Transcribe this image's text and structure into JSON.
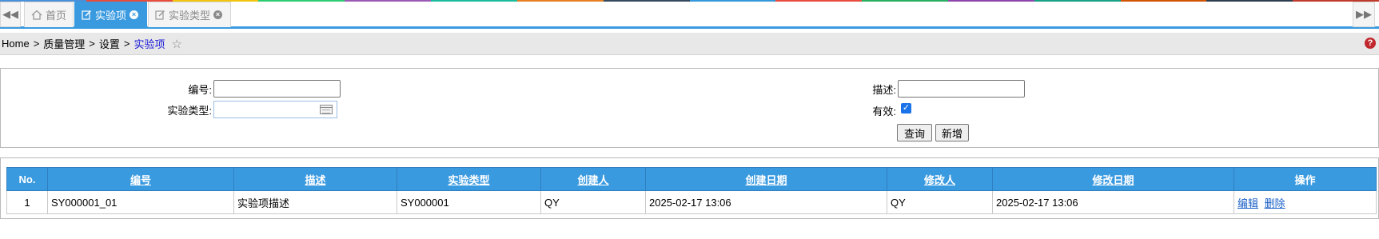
{
  "tabs": {
    "items": [
      {
        "label": "首页",
        "active": false
      },
      {
        "label": "实验项",
        "active": true
      },
      {
        "label": "实验类型",
        "active": false
      }
    ],
    "accent_color": "#3a9ae0"
  },
  "breadcrumb": {
    "home": "Home",
    "level1": "质量管理",
    "level2": "设置",
    "current": "实验项",
    "separator": ">"
  },
  "search": {
    "code_label": "编号:",
    "code_value": "",
    "type_label": "实验类型:",
    "type_value": "",
    "desc_label": "描述:",
    "desc_value": "",
    "valid_label": "有效:",
    "valid_checked": true,
    "query_button": "查询",
    "add_button": "新增"
  },
  "table": {
    "header_color": "#3a9ae0",
    "columns": [
      "No.",
      "编号",
      "描述",
      "实验类型",
      "创建人",
      "创建日期",
      "修改人",
      "修改日期",
      "操作"
    ],
    "rows": [
      {
        "no": "1",
        "code": "SY000001_01",
        "description": "实验项描述",
        "type": "SY000001",
        "creator": "QY",
        "created": "2025-02-17 13:06",
        "modifier": "QY",
        "modified": "2025-02-17 13:06",
        "actions": [
          "编辑",
          "删除"
        ]
      }
    ]
  },
  "icons": {
    "nav_left": "double-chevron-left-icon",
    "nav_right": "double-chevron-right-icon",
    "home": "home-icon",
    "edit": "edit-icon",
    "close": "close-icon",
    "star": "star-icon",
    "help": "help-icon",
    "calendar": "calendar-icon",
    "check": "check-icon"
  }
}
